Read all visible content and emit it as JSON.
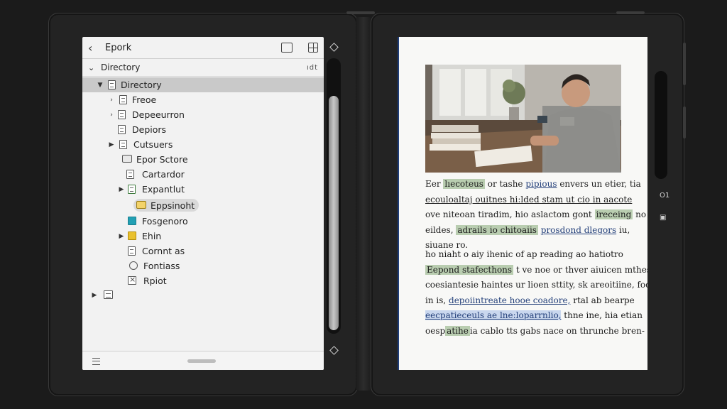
{
  "left_screen": {
    "toolbar": {
      "back_glyph": "‹",
      "title": "Epork"
    },
    "header": {
      "chevron": "⌄",
      "title": "Directory",
      "extra": "ıdt"
    },
    "tree": [
      {
        "label": "Directory",
        "arrow": "▼",
        "icon": "doc",
        "selected": true
      },
      {
        "label": "Freoe",
        "arrow": "›",
        "icon": "doc"
      },
      {
        "label": "Depeeurron",
        "arrow": "›",
        "icon": "doc"
      },
      {
        "label": "Depiors",
        "arrow": "",
        "icon": "doc"
      },
      {
        "label": "Cutsuers",
        "arrow": "▶",
        "icon": "doc"
      },
      {
        "label": "Epor Sctore",
        "arrow": "",
        "icon": "folder"
      },
      {
        "label": "Cartardor",
        "arrow": "",
        "icon": "doc"
      },
      {
        "label": "Expantlut",
        "arrow": "▶",
        "icon": "doc-green"
      },
      {
        "label": "Eppsinoht",
        "arrow": "",
        "icon": "folder-yellow",
        "highlighted": true
      },
      {
        "label": "Fosgenoro",
        "arrow": "",
        "icon": "teal"
      },
      {
        "label": "Ehin",
        "arrow": "▶",
        "icon": "yellow"
      },
      {
        "label": "Cornnt as",
        "arrow": "",
        "icon": "doc"
      },
      {
        "label": "Fontiass",
        "arrow": "",
        "icon": "circle"
      },
      {
        "label": "Rpiot",
        "arrow": "",
        "icon": "box"
      },
      {
        "label": "",
        "arrow": "▶",
        "icon": "calendar"
      }
    ]
  },
  "right_screen": {
    "status": {
      "top_label": "O1",
      "bottom_label": "▣"
    },
    "paragraph1": [
      [
        {
          "t": "Eer "
        },
        {
          "t": "lıecoteus",
          "s": "hl"
        },
        {
          "t": " or tashe "
        },
        {
          "t": "pipious",
          "s": "ul"
        },
        {
          "t": " envers un etier, tia"
        }
      ],
      [
        {
          "t": "ecouloaltaj ouitnes hi:lded stam ut cio in aacote",
          "s": "ul-part"
        }
      ],
      [
        {
          "t": "ove niteoan tiradim, hio aslactom gont "
        },
        {
          "t": "ireceing",
          "s": "hl"
        },
        {
          "t": " no"
        }
      ],
      [
        {
          "t": "eildes, "
        },
        {
          "t": "adrails io chitoaiis",
          "s": "hl"
        },
        {
          "t": " "
        },
        {
          "t": "prosdond dlegors",
          "s": "ul"
        },
        {
          "t": " iu,"
        }
      ],
      [
        {
          "t": "siuane ro."
        }
      ]
    ],
    "paragraph2": [
      [
        {
          "t": "  ho niaht o aiy ihenic of ap reading ao hatiotro"
        }
      ],
      [
        {
          "t": "Eepond stafecthons",
          "s": "hl"
        },
        {
          "t": " t ve noe or thver aiuicen mthes"
        }
      ],
      [
        {
          "t": "coesiantesie haintes ur lioen sttity, sk areoitiine, foo"
        }
      ],
      [
        {
          "t": "in is, "
        },
        {
          "t": "depoiintreate hooe coadore,",
          "s": "ul"
        },
        {
          "t": " rtal ab bearpe"
        }
      ],
      [
        {
          "t": "eecpatieceuls ae lne:loparrnlio,",
          "s": "hl-blue"
        },
        {
          "t": " thne ine, hia etian"
        }
      ],
      [
        {
          "t": "oesp"
        },
        {
          "t": "atihe",
          "s": "hl"
        },
        {
          "t": "ia cablo tts gabs nace on thrunche bren-"
        }
      ]
    ]
  },
  "colors": {
    "accent_blue": "#1e3d7a",
    "highlight_green": "#b9cdb0",
    "selection_gray": "#c9c9c9"
  }
}
